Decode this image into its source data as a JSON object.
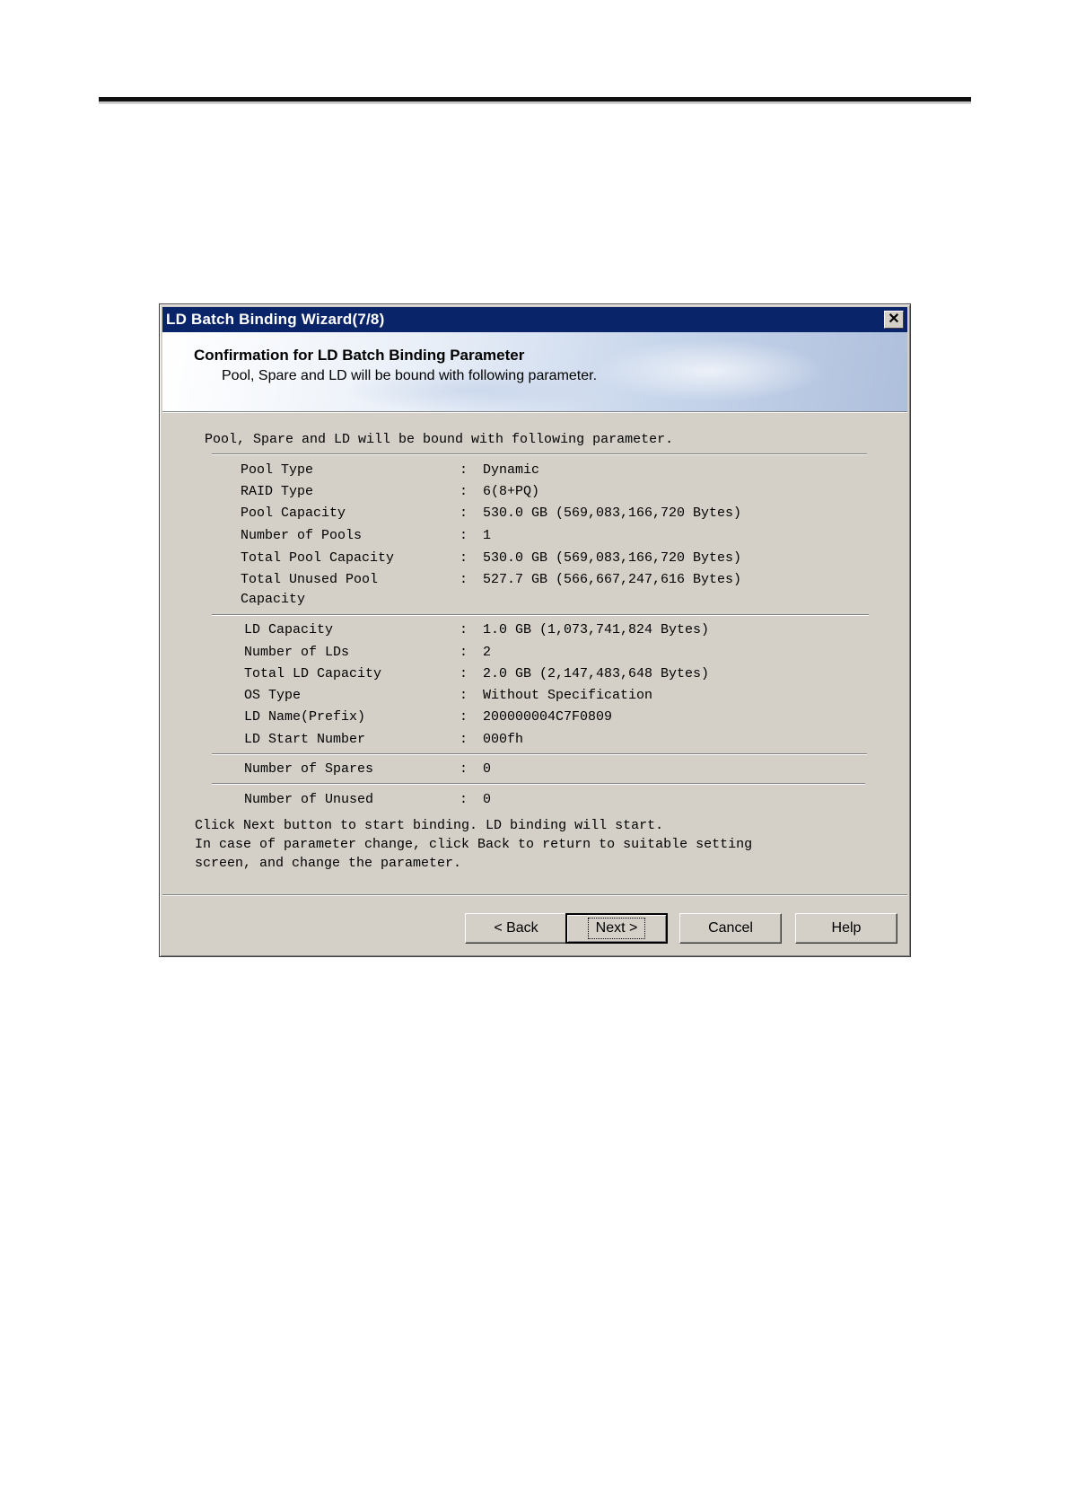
{
  "dialog": {
    "title": "LD Batch Binding Wizard(7/8)",
    "close_glyph": "✕",
    "header_title": "Confirmation for LD Batch Binding Parameter",
    "header_subtitle": "Pool, Spare and LD will be bound with following parameter.",
    "intro": "Pool, Spare and LD will be bound with following parameter.",
    "pool_rows": [
      {
        "label": "Pool Type",
        "value": "Dynamic"
      },
      {
        "label": "RAID Type",
        "value": "6(8+PQ)"
      },
      {
        "label": "Pool Capacity",
        "value": "530.0 GB (569,083,166,720 Bytes)"
      },
      {
        "label": "Number of Pools",
        "value": "1"
      },
      {
        "label": "Total Pool Capacity",
        "value": "530.0 GB (569,083,166,720 Bytes)"
      },
      {
        "label": "Total Unused Pool",
        "label2": "Capacity",
        "value": "527.7 GB (566,667,247,616 Bytes)"
      }
    ],
    "ld_rows": [
      {
        "label": "LD Capacity",
        "value": "1.0 GB (1,073,741,824 Bytes)"
      },
      {
        "label": "Number of LDs",
        "value": "2"
      },
      {
        "label": "Total LD Capacity",
        "value": "2.0 GB (2,147,483,648 Bytes)"
      },
      {
        "label": "OS Type",
        "value": "Without Specification"
      },
      {
        "label": "LD Name(Prefix)",
        "value": "200000004C7F0809"
      },
      {
        "label": "LD Start Number",
        "value": "000fh"
      }
    ],
    "spare_row": {
      "label": "Number of Spares",
      "value": "0"
    },
    "unused_row": {
      "label": "Number of Unused",
      "value": "0"
    },
    "colon": ":",
    "note_lines": [
      "Click Next button to start binding. LD binding will start.",
      "In case of parameter change, click Back to return to suitable setting",
      "screen, and change the parameter."
    ],
    "buttons": {
      "back": "< Back",
      "next": "Next >",
      "cancel": "Cancel",
      "help": "Help"
    }
  }
}
